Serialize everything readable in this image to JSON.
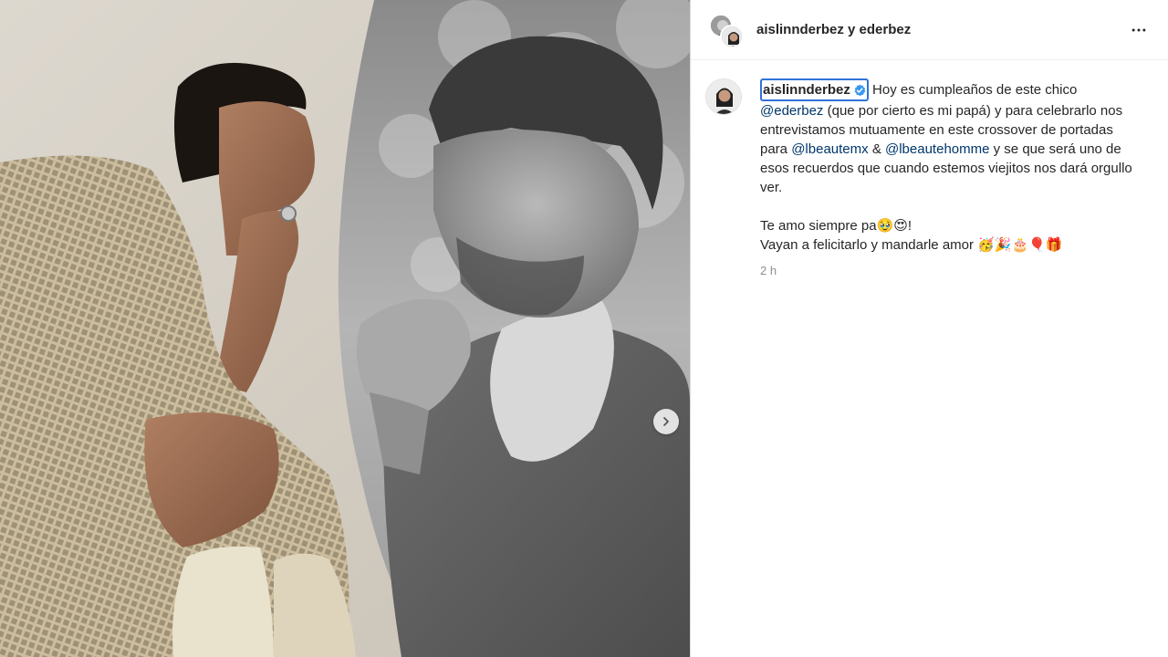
{
  "post": {
    "header": {
      "owner": "aislinnderbez",
      "conjunction": "y",
      "collaborator": "ederbez",
      "more_icon": "more-horizontal-icon"
    },
    "caption": {
      "username": "aislinnderbez",
      "verified_icon": "verified-badge-icon",
      "text_1": "Hoy es cumpleaños de este chico",
      "mention_1": "@ederbez",
      "text_2": "(que por cierto es mi papá) y para celebrarlo nos entrevistamos mutuamente en este crossover de portadas para",
      "mention_2": "@lbeautemx",
      "text_3": "&",
      "mention_3": "@lbeautehomme",
      "text_4": "y se que será uno de esos recuerdos que cuando estemos viejitos nos dará orgullo ver.",
      "line_2": "Te amo siempre pa🥹😍!",
      "line_3": "Vayan a felicitarlo y mandarle amor 🥳🎉🎂🎈🎁",
      "time": "2 h"
    },
    "media": {
      "next_icon": "chevron-right-icon"
    },
    "colors": {
      "mention": "#00376b",
      "highlight": "#2f72d8",
      "verified": "#3897f0"
    }
  }
}
